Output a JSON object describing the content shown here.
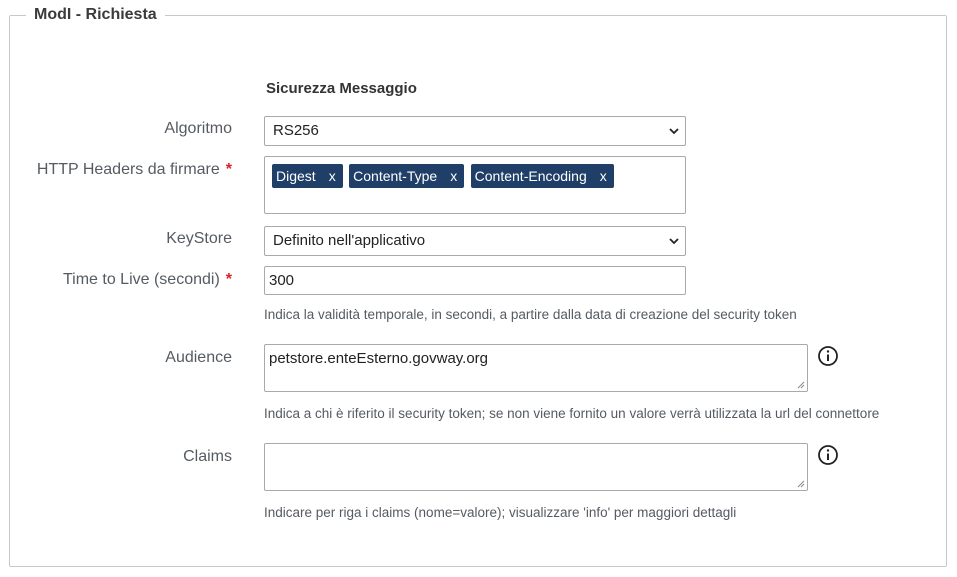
{
  "panel": {
    "legend": "ModI - Richiesta",
    "section_title": "Sicurezza Messaggio"
  },
  "fields": {
    "algoritmo": {
      "label": "Algoritmo",
      "value": "RS256"
    },
    "headers": {
      "label": "HTTP Headers da firmare",
      "required_mark": "*",
      "tags": [
        {
          "label": "Digest",
          "remove": "x"
        },
        {
          "label": "Content-Type",
          "remove": "x"
        },
        {
          "label": "Content-Encoding",
          "remove": "x"
        }
      ]
    },
    "keystore": {
      "label": "KeyStore",
      "value": "Definito nell'applicativo"
    },
    "ttl": {
      "label": "Time to Live (secondi)",
      "required_mark": "*",
      "value": "300",
      "help": "Indica la validità temporale, in secondi, a partire dalla data di creazione del security token"
    },
    "audience": {
      "label": "Audience",
      "value": "petstore.enteEsterno.govway.org",
      "help": "Indica a chi è riferito il security token; se non viene fornito un valore verrà utilizzata la url del connettore"
    },
    "claims": {
      "label": "Claims",
      "value": "",
      "help": "Indicare per riga i claims (nome=valore); visualizzare 'info' per maggiori dettagli"
    }
  },
  "icons": {
    "info": "info-circle-icon",
    "dropdown": "chevron-down-icon",
    "resize": "resize-grip-icon"
  },
  "colors": {
    "tag_bg": "#1f3f68",
    "required": "#d9202a",
    "label": "#555b62"
  }
}
